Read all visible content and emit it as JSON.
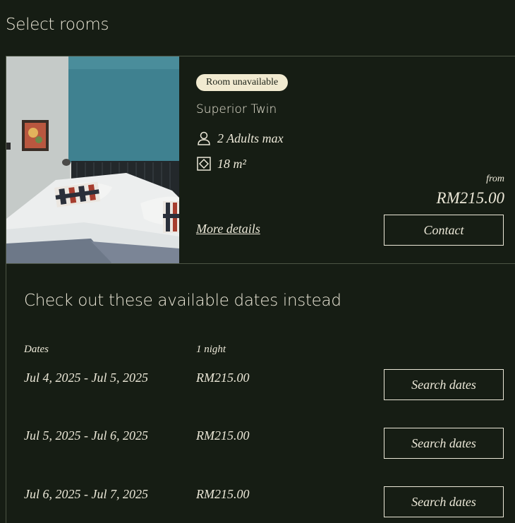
{
  "page": {
    "heading": "Select rooms"
  },
  "room": {
    "status_badge": "Room unavailable",
    "name": "Superior Twin",
    "guests": "2 Adults max",
    "size": "18 m²",
    "from_label": "from",
    "price": "RM215.00",
    "more_details_label": "More details",
    "contact_label": "Contact",
    "icons": {
      "guests": "person-icon",
      "size": "room-size-icon"
    }
  },
  "alternatives": {
    "title": "Check out these available dates instead",
    "headers": {
      "dates": "Dates",
      "nights": "1 night"
    },
    "rows": [
      {
        "dates": "Jul 4, 2025 - Jul 5, 2025",
        "price": "RM215.00",
        "button": "Search dates"
      },
      {
        "dates": "Jul 5, 2025 - Jul 6, 2025",
        "price": "RM215.00",
        "button": "Search dates"
      },
      {
        "dates": "Jul 6, 2025 - Jul 7, 2025",
        "price": "RM215.00",
        "button": "Search dates"
      }
    ]
  },
  "colors": {
    "background": "#161d14",
    "text": "#ece8d8",
    "badge_background": "#f1ead0",
    "divider": "#4c5444"
  }
}
